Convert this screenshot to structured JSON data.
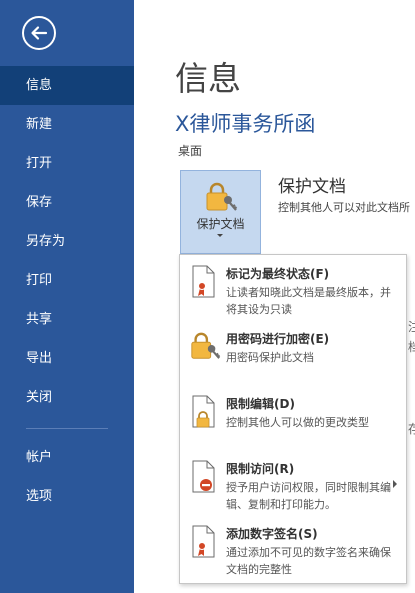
{
  "sidebar": {
    "back_icon": "back-arrow-icon",
    "items": [
      {
        "label": "信息",
        "active": true
      },
      {
        "label": "新建"
      },
      {
        "label": "打开"
      },
      {
        "label": "保存"
      },
      {
        "label": "另存为"
      },
      {
        "label": "打印"
      },
      {
        "label": "共享"
      },
      {
        "label": "导出"
      },
      {
        "label": "关闭"
      },
      {
        "label": "帐户"
      },
      {
        "label": "选项"
      }
    ]
  },
  "main": {
    "page_title": "信息",
    "doc_title": "X律师事务所函",
    "doc_location": "桌面",
    "protect": {
      "button_label": "保护文档",
      "section_title": "保护文档",
      "section_desc": "控制其他人可以对此文档所"
    },
    "background_fragments": [
      "注",
      "档",
      "存"
    ]
  },
  "menu": {
    "items": [
      {
        "title": "标记为最终状态(F)",
        "desc": "让读者知晓此文档是最终版本，并将其设为只读",
        "icon": "document-ribbon-icon"
      },
      {
        "title": "用密码进行加密(E)",
        "desc": "用密码保护此文档",
        "icon": "lock-key-icon"
      },
      {
        "title": "限制编辑(D)",
        "desc": "控制其他人可以做的更改类型",
        "icon": "document-lock-icon"
      },
      {
        "title": "限制访问(R)",
        "desc": "授予用户访问权限，同时限制其编辑、复制和打印能力。",
        "icon": "document-restrict-icon",
        "has_submenu": true
      },
      {
        "title": "添加数字签名(S)",
        "desc": "通过添加不可见的数字签名来确保文档的完整性",
        "icon": "document-ribbon-icon"
      }
    ]
  },
  "colors": {
    "sidebar": "#2b579a",
    "sidebar_active": "#124078",
    "accent_title": "#2b579a",
    "button_highlight": "#c5d8ef",
    "lock_gold": "#f2b740"
  }
}
